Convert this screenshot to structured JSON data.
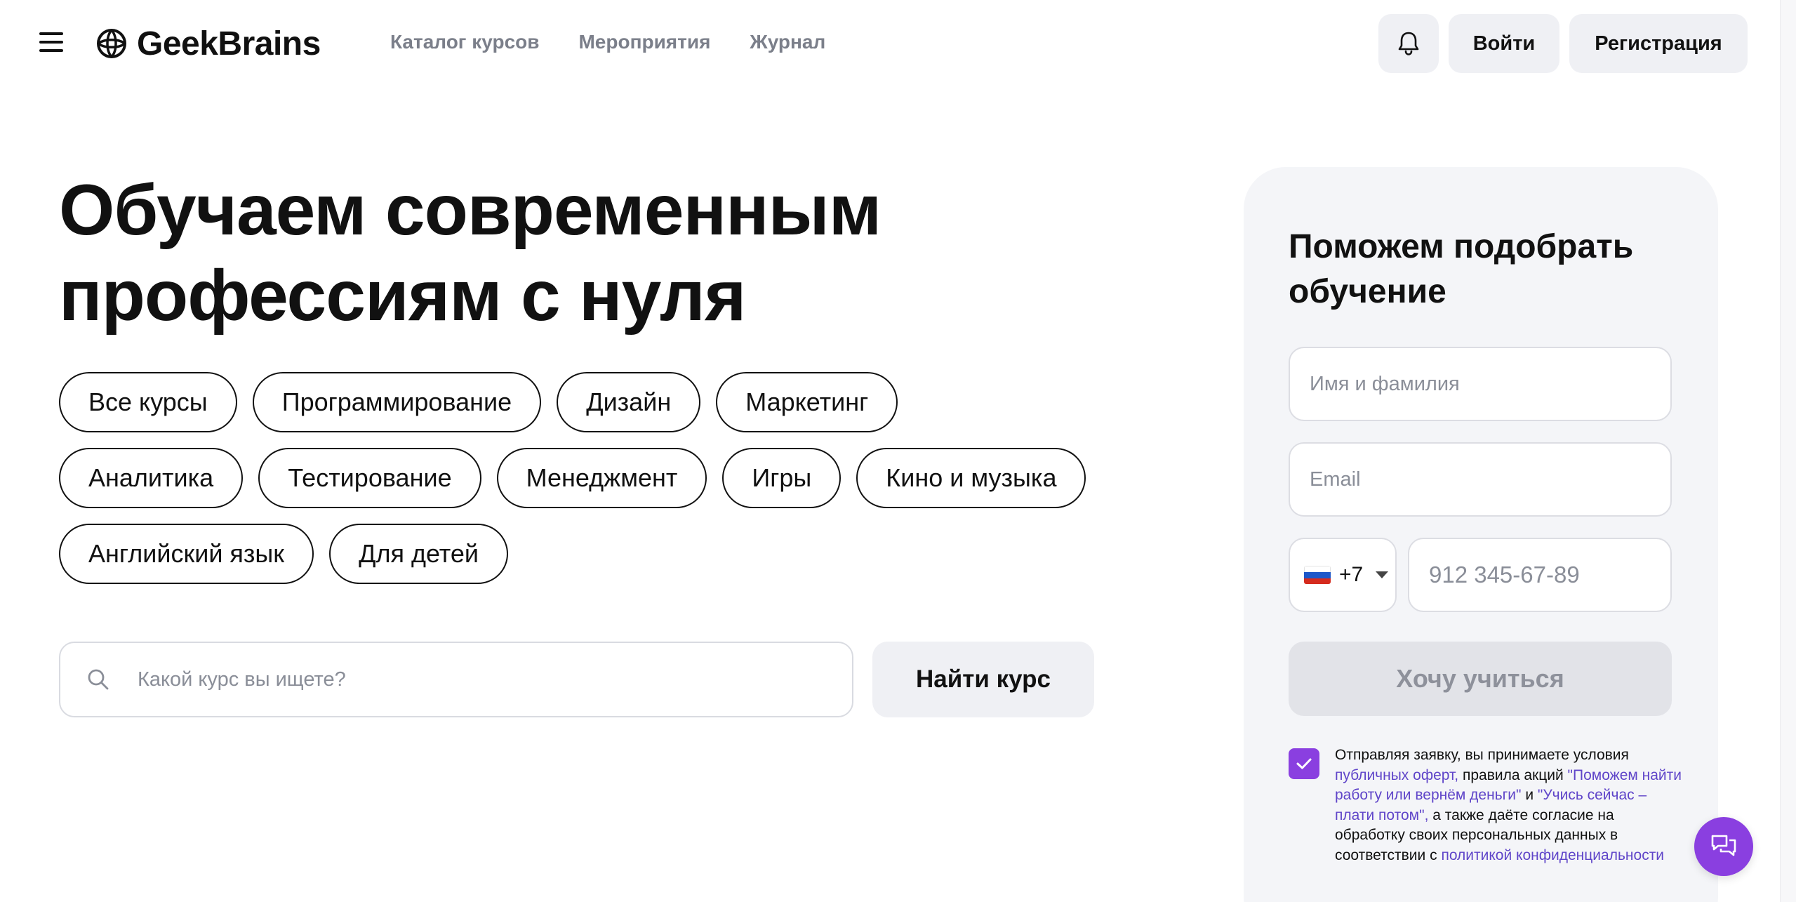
{
  "header": {
    "logo_text": "GeekBrains",
    "nav": [
      "Каталог курсов",
      "Мероприятия",
      "Журнал"
    ],
    "login_label": "Войти",
    "register_label": "Регистрация"
  },
  "hero": {
    "title_line1": "Обучаем современным",
    "title_line2": "профессиям с нуля",
    "tags": [
      [
        "Все курсы",
        "Программирование",
        "Дизайн",
        "Маркетинг"
      ],
      [
        "Аналитика",
        "Тестирование",
        "Менеджмент",
        "Игры",
        "Кино и музыка"
      ],
      [
        "Английский язык",
        "Для детей"
      ]
    ],
    "search_placeholder": "Какой курс вы ищете?",
    "search_button": "Найти курс"
  },
  "form": {
    "title": "Поможем подобрать обучение",
    "name_placeholder": "Имя и фамилия",
    "email_placeholder": "Email",
    "phone_code": "+7",
    "phone_placeholder": "912 345-67-89",
    "submit_label": "Хочу учиться",
    "consent": {
      "checked": true,
      "t1": "Отправляя заявку, вы принимаете условия ",
      "link1": "публичных оферт,",
      "t2": " правила акций ",
      "link2": "\"Поможем найти работу или вернём деньги\"",
      "t3": " и ",
      "link3": "\"Учись сейчас – плати потом\",",
      "t4": " а также даёте согласие на обработку своих персональных данных в соответствии с ",
      "link4": "политикой конфиденциальности"
    }
  },
  "colors": {
    "accent": "#8a3fe0",
    "link": "#5f45c9",
    "button_bg": "#eff0f4",
    "card_bg": "#f4f5f8"
  },
  "icons": [
    "menu-icon",
    "geekbrains-logo-icon",
    "bell-icon",
    "search-icon",
    "russia-flag-icon",
    "chevron-down-icon",
    "check-icon",
    "chat-icon"
  ]
}
